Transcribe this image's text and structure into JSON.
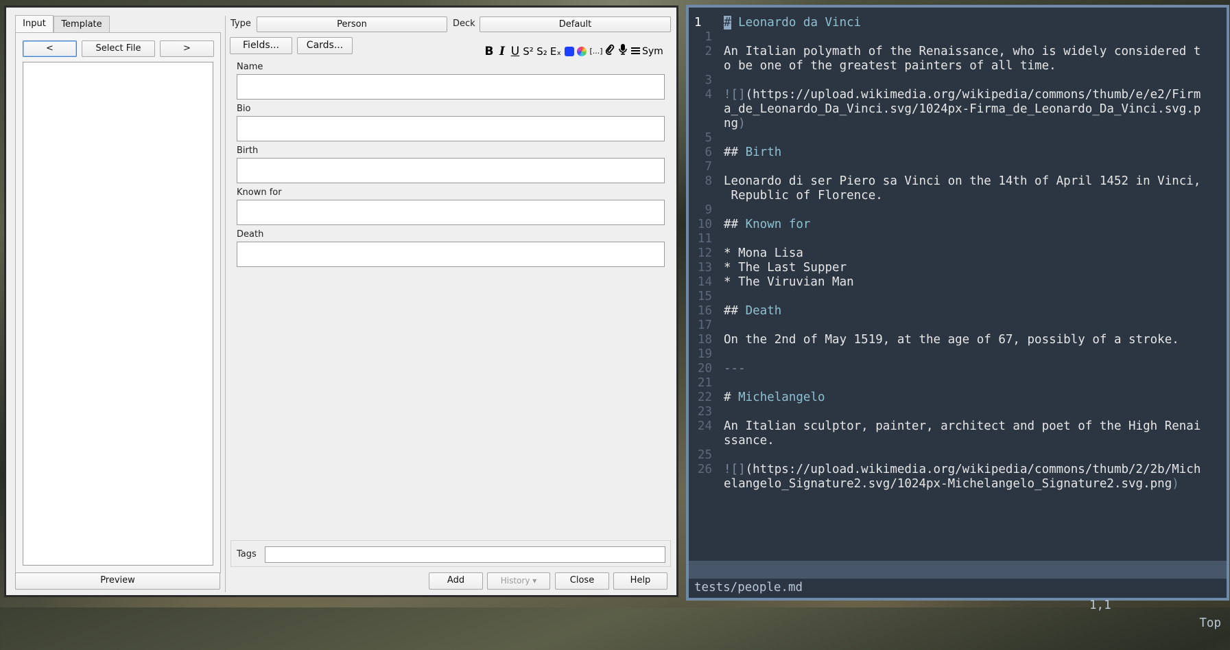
{
  "anki": {
    "tabs": [
      "Input",
      "Template"
    ],
    "nav": {
      "prev": "<",
      "select_file": "Select File",
      "next": ">"
    },
    "preview": "Preview",
    "type_label": "Type",
    "type_value": "Person",
    "deck_label": "Deck",
    "deck_value": "Default",
    "fields_button": "Fields...",
    "cards_button": "Cards...",
    "toolbar": {
      "bold": "B",
      "italic": "I",
      "underline": "U",
      "superscript": "S²",
      "subscript": "S₂",
      "clear": "Eₓ",
      "ellipsis": "[...]",
      "symbol": "Sym",
      "text_color": "#1f3fff"
    },
    "fields": [
      "Name",
      "Bio",
      "Birth",
      "Known for",
      "Death"
    ],
    "tags_label": "Tags",
    "buttons": {
      "add": "Add",
      "history": "History ▾",
      "close": "Close",
      "help": "Help"
    }
  },
  "vim": {
    "lines": [
      {
        "n": "1",
        "cur": true,
        "mark": "#",
        "text": " Leonardo da Vinci",
        "type": "h"
      },
      {
        "n": "1",
        "text": ""
      },
      {
        "n": "2",
        "text": "An Italian polymath of the Renaissance, who is widely considered t"
      },
      {
        "n": "",
        "text": "o be one of the greatest painters of all time."
      },
      {
        "n": "3",
        "text": ""
      },
      {
        "n": "4",
        "mark": "![]",
        "text": "(https://upload.wikimedia.org/wikipedia/commons/thumb/e/e2/Firm",
        "type": "img"
      },
      {
        "n": "",
        "text": "a_de_Leonardo_Da_Vinci.svg/1024px-Firma_de_Leonardo_Da_Vinci.svg.p"
      },
      {
        "n": "",
        "text": "ng",
        "tail": ")"
      },
      {
        "n": "5",
        "text": ""
      },
      {
        "n": "6",
        "mark": "##",
        "text": " Birth",
        "type": "h"
      },
      {
        "n": "7",
        "text": ""
      },
      {
        "n": "8",
        "text": "Leonardo di ser Piero sa Vinci on the 14th of April 1452 in Vinci,"
      },
      {
        "n": "",
        "text": " Republic of Florence."
      },
      {
        "n": "9",
        "text": ""
      },
      {
        "n": "10",
        "mark": "##",
        "text": " Known for",
        "type": "h"
      },
      {
        "n": "11",
        "text": ""
      },
      {
        "n": "12",
        "text": "* Mona Lisa"
      },
      {
        "n": "13",
        "text": "* The Last Supper"
      },
      {
        "n": "14",
        "text": "* The Viruvian Man"
      },
      {
        "n": "15",
        "text": ""
      },
      {
        "n": "16",
        "mark": "##",
        "text": " Death",
        "type": "h"
      },
      {
        "n": "17",
        "text": ""
      },
      {
        "n": "18",
        "text": "On the 2nd of May 1519, at the age of 67, possibly of a stroke."
      },
      {
        "n": "19",
        "text": ""
      },
      {
        "n": "20",
        "mark": "---",
        "text": "",
        "type": "rule"
      },
      {
        "n": "21",
        "text": ""
      },
      {
        "n": "22",
        "mark": "#",
        "text": " Michelangelo",
        "type": "h"
      },
      {
        "n": "23",
        "text": ""
      },
      {
        "n": "24",
        "text": "An Italian sculptor, painter, architect and poet of the High Renai"
      },
      {
        "n": "",
        "text": "ssance."
      },
      {
        "n": "25",
        "text": ""
      },
      {
        "n": "26",
        "mark": "![]",
        "text": "(https://upload.wikimedia.org/wikipedia/commons/thumb/2/2b/Mich",
        "type": "img"
      },
      {
        "n": "",
        "text": "elangelo_Signature2.svg/1024px-Michelangelo_Signature2.svg.png",
        "tail": ")"
      }
    ],
    "status": {
      "file": "tests/people.md",
      "pos": "1,1",
      "scroll": "Top"
    }
  }
}
